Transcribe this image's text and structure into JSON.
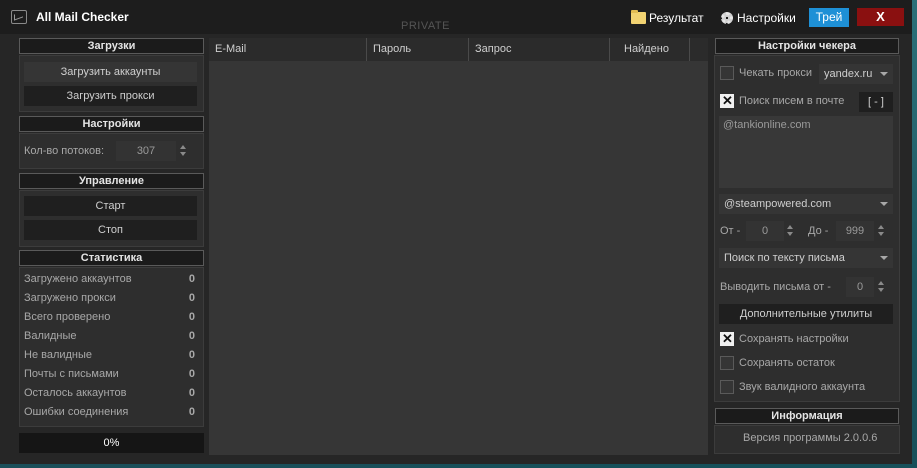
{
  "titlebar": {
    "app_title": "All Mail Checker",
    "private_label": "PRIVATE",
    "results_label": "Результат",
    "settings_label": "Настройки",
    "tray_label": "Трей",
    "close_label": "X"
  },
  "left": {
    "downloads_header": "Загрузки",
    "load_accounts": "Загрузить аккаунты",
    "load_proxies": "Загрузить прокси",
    "settings_header": "Настройки",
    "threads_label": "Кол-во потоков:",
    "threads_value": "307",
    "control_header": "Управление",
    "start_label": "Старт",
    "stop_label": "Стоп",
    "stats_header": "Статистика",
    "stats": [
      {
        "label": "Загружено аккаунтов",
        "value": "0"
      },
      {
        "label": "Загружено прокси",
        "value": "0"
      },
      {
        "label": "Всего проверено",
        "value": "0"
      },
      {
        "label": "Валидные",
        "value": "0"
      },
      {
        "label": "Не валидные",
        "value": "0"
      },
      {
        "label": "Почты с письмами",
        "value": "0"
      },
      {
        "label": "Осталось аккаунтов",
        "value": "0"
      },
      {
        "label": "Ошибки соединения",
        "value": "0"
      }
    ],
    "progress": "0%"
  },
  "table": {
    "columns": [
      "E-Mail",
      "Пароль",
      "Запрос",
      "Найдено"
    ],
    "rows": []
  },
  "right": {
    "header": "Настройки чекера",
    "check_proxy_label": "Чекать прокси",
    "check_proxy_checked": false,
    "proxy_site": "yandex.ru",
    "search_mail_label": "Поиск писем в почте",
    "search_mail_checked": true,
    "bracket_button": "[ - ]",
    "search_text": "@tankionline.com",
    "domain_select": "@steampowered.com",
    "from_label": "От -",
    "from_value": "0",
    "to_label": "До -",
    "to_value": "999",
    "search_mode": "Поиск по тексту письма",
    "output_from_label": "Выводить письма от -",
    "output_from_value": "0",
    "extra_utils": "Дополнительные утилиты",
    "save_settings_label": "Сохранять настройки",
    "save_settings_checked": true,
    "save_rest_label": "Сохранять остаток",
    "save_rest_checked": false,
    "valid_sound_label": "Звук валидного аккаунта",
    "valid_sound_checked": false,
    "info_header": "Информация",
    "version": "Версия программы 2.0.0.6"
  },
  "colors": {
    "tray": "#1e90d6",
    "close": "#8a1010",
    "window_bg": "#262626"
  }
}
